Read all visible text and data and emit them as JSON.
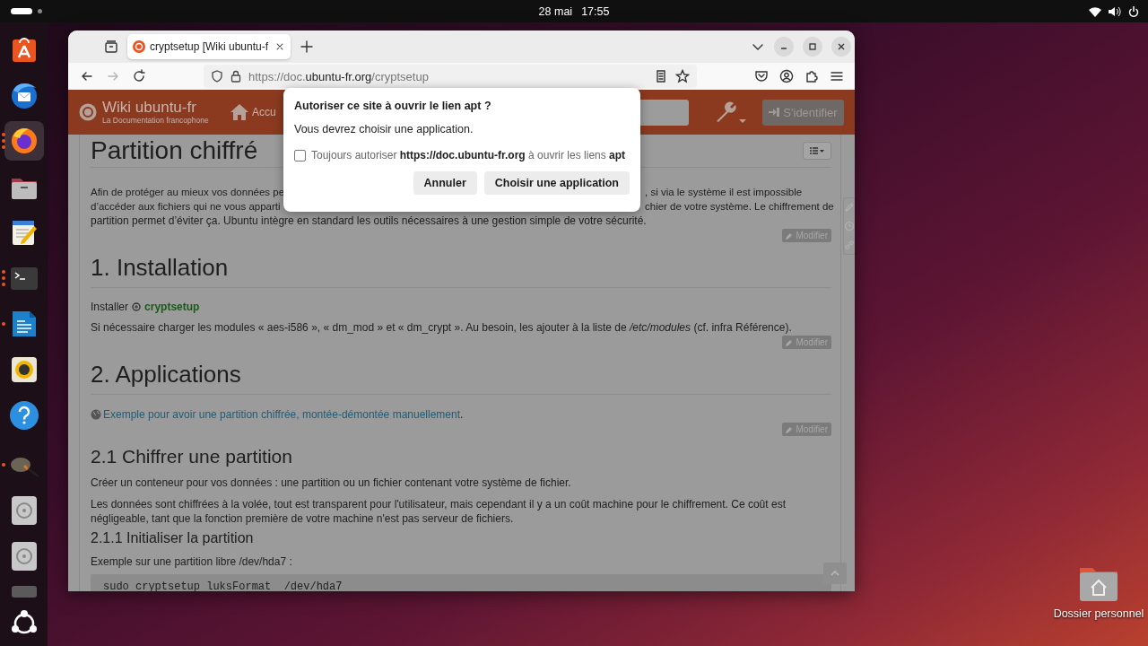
{
  "top_bar": {
    "date": "28 mai",
    "time": "17:55"
  },
  "dock": {
    "items": [
      {
        "selected": false,
        "running": false
      },
      {
        "selected": false,
        "running": false
      },
      {
        "selected": true,
        "running": true,
        "multiple_windows": true
      },
      {
        "selected": false,
        "running": false
      },
      {
        "selected": false,
        "running": false
      },
      {
        "selected": false,
        "running": true,
        "multiple_windows": true
      },
      {
        "selected": false,
        "running": true,
        "multiple_windows": false
      },
      {
        "selected": false,
        "running": false
      },
      {
        "selected": false,
        "running": false
      },
      {
        "selected": false,
        "running": true,
        "multiple_windows": false
      },
      {
        "selected": false,
        "running": false
      },
      {
        "selected": false,
        "running": false
      },
      {
        "selected": false,
        "running": false
      },
      {
        "selected": false,
        "running": false
      }
    ]
  },
  "browser": {
    "tab": {
      "title": "cryptsetup [Wiki ubuntu-f",
      "selected": true
    },
    "back": {
      "disabled": false
    },
    "forward": {
      "disabled": true
    },
    "url": {
      "start": "https://doc.",
      "domain": "ubuntu-fr.org",
      "path": "/cryptsetup"
    }
  },
  "site": {
    "logo_title": "Wiki ubuntu-fr",
    "logo_subtitle": "La Documentation francophone",
    "nav_item": "Accu",
    "login": "S'identifier"
  },
  "article": {
    "title": "Partition chiffré",
    "intro": {
      "lines": [
        {
          "left": "Afin de protéger au mieux vos données pe",
          "right": ", si via le système il est impossible"
        },
        {
          "left": "d’accéder aux fichiers qui ne vous apparti",
          "right": "chier de votre système. Le chiffrement de"
        }
      ],
      "last": "partition permet d’éviter ça. Ubuntu intègre en standard les outils nécessaires à une gestion simple de votre sécurité."
    },
    "blocks": [
      {
        "kind": "modifier",
        "label": "Modifier"
      },
      {
        "kind": "h2",
        "text": "1. Installation"
      },
      {
        "kind": "install",
        "label": "Installer",
        "package": "cryptsetup"
      },
      {
        "kind": "p",
        "text": "Si nécessaire charger les modules « aes-i586 », « dm_mod » et « dm_crypt ». Au besoin, les ajouter à la liste de */etc/modules* (cf. infra Référence)."
      },
      {
        "kind": "modifier",
        "label": "Modifier"
      },
      {
        "kind": "h2",
        "text": "2. Applications"
      },
      {
        "kind": "link",
        "text": "Exemple pour avoir une partition chiffrée, montée-démontée manuellement",
        "after": "."
      },
      {
        "kind": "modifier",
        "label": "Modifier"
      },
      {
        "kind": "h3",
        "text": "2.1 Chiffrer une partition"
      },
      {
        "kind": "p",
        "text": "Créer un conteneur pour vos données : une partition ou un fichier contenant votre système de fichier."
      },
      {
        "kind": "p",
        "text": "Les données sont chiffrées à la volée, tout est transparent pour l'utilisateur, mais cependant il y a un coût machine pour le chiffrement. Ce coût est négligeable, tant que la fonction première de votre machine n'est pas serveur de fichiers."
      },
      {
        "kind": "h4",
        "text": "2.1.1 Initialiser la partition"
      },
      {
        "kind": "p",
        "text": "Exemple sur une partition libre /dev/hda7 :"
      },
      {
        "kind": "code",
        "text": "sudo cryptsetup luksFormat  /dev/hda7"
      }
    ]
  },
  "dialog": {
    "title": "Autoriser ce site à ouvrir le lien apt ?",
    "message": "Vous devrez choisir une application.",
    "checkbox": {
      "label": "Toujours autoriser **https://doc.ubuntu-fr.org** à ouvrir les liens **apt**",
      "checked": false
    },
    "buttons": [
      "Annuler",
      "Choisir une application"
    ]
  },
  "desktop_icon": {
    "label": "Dossier personnel"
  }
}
